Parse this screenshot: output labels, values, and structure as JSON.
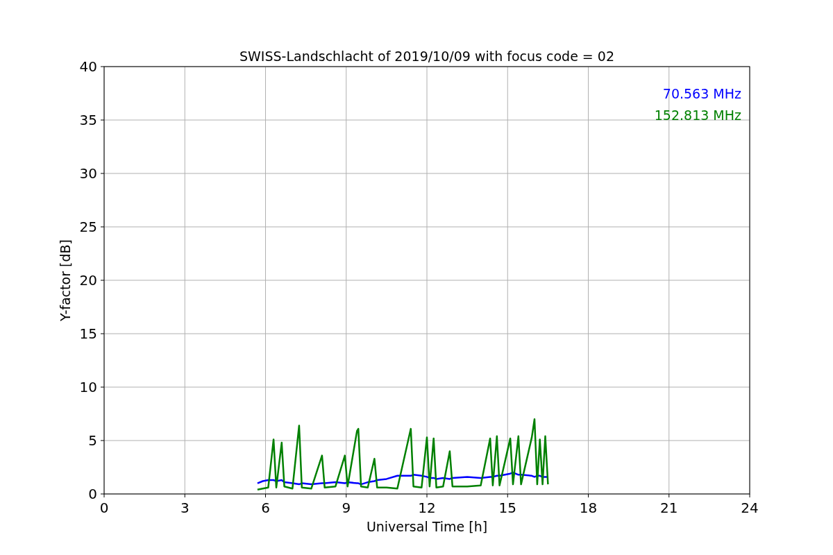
{
  "chart_data": {
    "type": "line",
    "title": "SWISS-Landschlacht of 2019/10/09 with focus code = 02",
    "xlabel": "Universal Time [h]",
    "ylabel": "Y-factor [dB]",
    "x": [
      5.7,
      5.9,
      6.1,
      6.3,
      6.4,
      6.6,
      6.7,
      7.0,
      7.25,
      7.35,
      7.7,
      8.1,
      8.2,
      8.6,
      8.95,
      9.05,
      9.4,
      9.45,
      9.55,
      9.8,
      10.05,
      10.15,
      10.5,
      10.9,
      11.4,
      11.5,
      11.8,
      12.0,
      12.1,
      12.25,
      12.35,
      12.6,
      12.85,
      12.95,
      13.5,
      14.0,
      14.35,
      14.45,
      14.6,
      14.7,
      15.1,
      15.2,
      15.4,
      15.5,
      15.9,
      16.0,
      16.1,
      16.2,
      16.3,
      16.4,
      16.5
    ],
    "series": [
      {
        "name": "70.563 MHz",
        "color": "#0000ff",
        "values": [
          1.0,
          1.2,
          1.3,
          1.3,
          1.2,
          1.3,
          1.1,
          1.0,
          0.9,
          1.0,
          0.9,
          1.0,
          1.0,
          1.1,
          1.0,
          1.1,
          1.0,
          1.0,
          0.9,
          1.1,
          1.2,
          1.3,
          1.4,
          1.7,
          1.7,
          1.8,
          1.7,
          1.6,
          1.5,
          1.5,
          1.4,
          1.5,
          1.4,
          1.5,
          1.6,
          1.5,
          1.6,
          1.6,
          1.7,
          1.7,
          1.9,
          2.0,
          1.8,
          1.8,
          1.7,
          1.6,
          1.7,
          1.7,
          1.6,
          1.6,
          1.6
        ]
      },
      {
        "name": "152.813 MHz",
        "color": "#008000",
        "values": [
          0.4,
          0.5,
          0.6,
          5.1,
          0.6,
          4.8,
          0.7,
          0.5,
          6.4,
          0.6,
          0.5,
          3.6,
          0.6,
          0.7,
          3.6,
          0.7,
          5.9,
          6.1,
          0.7,
          0.6,
          3.3,
          0.6,
          0.6,
          0.5,
          6.1,
          0.7,
          0.6,
          5.3,
          0.7,
          5.2,
          0.6,
          0.7,
          4.0,
          0.7,
          0.7,
          0.8,
          5.2,
          0.8,
          5.4,
          0.8,
          5.2,
          0.9,
          5.4,
          0.9,
          5.3,
          7.0,
          0.9,
          5.1,
          0.9,
          5.4,
          0.9
        ]
      }
    ],
    "xlim": [
      0,
      24
    ],
    "ylim": [
      0,
      40
    ],
    "xticks": [
      0,
      3,
      6,
      9,
      12,
      15,
      18,
      21,
      24
    ],
    "yticks": [
      0,
      5,
      10,
      15,
      20,
      25,
      30,
      35,
      40
    ],
    "grid": true
  }
}
